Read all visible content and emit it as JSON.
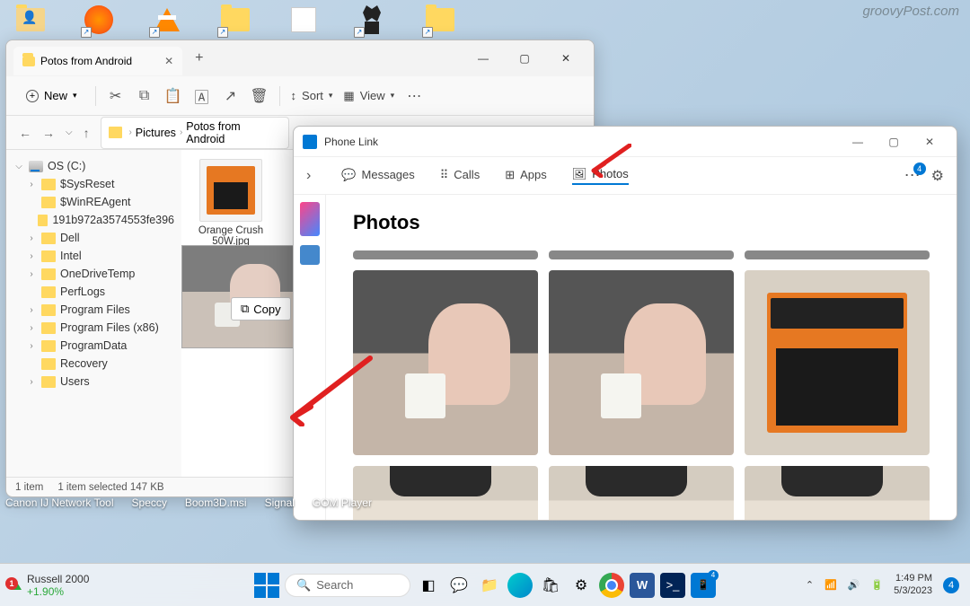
{
  "watermark": "groovyPost.com",
  "explorer": {
    "tab_title": "Potos from Android",
    "new_label": "New",
    "sort_label": "Sort",
    "view_label": "View",
    "breadcrumb": {
      "level1": "Pictures",
      "level2": "Potos from Android"
    },
    "tree": {
      "drive": "OS (C:)",
      "items": [
        "$SysReset",
        "$WinREAgent",
        "191b972a3574553fe396",
        "Dell",
        "Intel",
        "OneDriveTemp",
        "PerfLogs",
        "Program Files",
        "Program Files (x86)",
        "ProgramData",
        "Recovery",
        "Users"
      ]
    },
    "file": {
      "name_l1": "Orange Crush",
      "name_l2": "50W.jpg"
    },
    "copy_tooltip": "Copy",
    "status": {
      "count": "1 item",
      "selected": "1 item selected  147 KB"
    }
  },
  "phonelink": {
    "title": "Phone Link",
    "tabs": {
      "messages": "Messages",
      "calls": "Calls",
      "apps": "Apps",
      "photos": "Photos"
    },
    "badge": "4",
    "heading": "Photos"
  },
  "desktop_labels": [
    "Canon IJ Network Tool",
    "Speccy",
    "Boom3D.msi",
    "Signal",
    "GOM Player"
  ],
  "taskbar": {
    "stock_name": "Russell 2000",
    "stock_change": "+1.90%",
    "stock_badge": "1",
    "search_placeholder": "Search",
    "time": "1:49 PM",
    "date": "5/3/2023",
    "notif_count": "4"
  }
}
